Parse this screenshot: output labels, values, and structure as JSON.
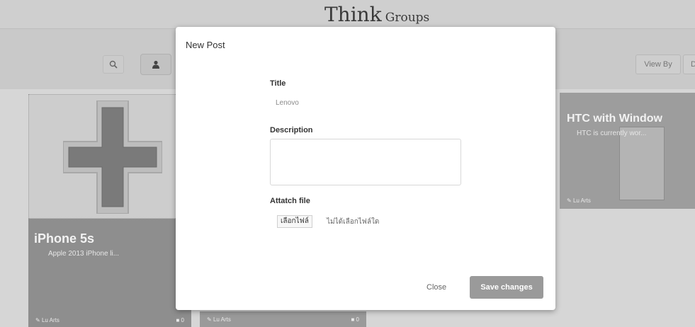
{
  "app": {
    "brand_main": "Think",
    "brand_sub": "Groups"
  },
  "toolbar": {
    "view_by_label": "View By",
    "view_by_next_label": "D"
  },
  "cards": [
    {
      "title": "iPhone 5s",
      "description": "Apple 2013 iPhone li...",
      "author": "Lu Arts",
      "comments": "0"
    },
    {
      "author": "Lu Arts",
      "comments": "0"
    },
    {
      "title": "HTC with Window",
      "description": "HTC is currently wor...",
      "author": "Lu Arts"
    }
  ],
  "modal": {
    "title": "New Post",
    "title_label": "Title",
    "title_value": "Lenovo",
    "description_label": "Description",
    "attach_label": "Attatch file",
    "file_button_label": "เลือกไฟล์",
    "file_status": "ไม่ได้เลือกไฟล์ใด",
    "close_label": "Close",
    "save_label": "Save changes"
  },
  "colors": {
    "overlay": "#d2d2d2",
    "modal_bg": "#ffffff",
    "save_button": "#9a9a9a",
    "card_dark": "#8e8e8e"
  }
}
